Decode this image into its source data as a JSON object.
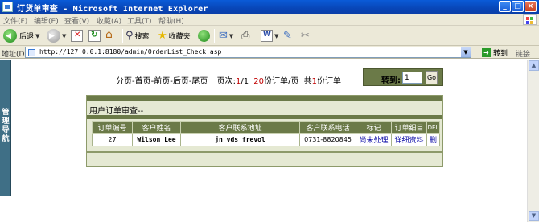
{
  "window": {
    "title": "订货单审查 - Microsoft Internet Explorer",
    "buttons": {
      "minimize": "_",
      "maximize": "□",
      "close": "×"
    }
  },
  "menu": [
    "文件(F)",
    "编辑(E)",
    "查看(V)",
    "收藏(A)",
    "工具(T)",
    "帮助(H)"
  ],
  "toolbar": {
    "back_label": "后退",
    "search_label": "搜索",
    "favorites_label": "收藏夹"
  },
  "address": {
    "label": "地址(D)",
    "url": "http://127.0.0.1:8180/admin/OrderList_Check.asp",
    "go_label": "转到",
    "links_label": "链接"
  },
  "sidebar": {
    "label": "管理导航"
  },
  "pager": {
    "first_parts": "分页-首页-前页-后页-尾页",
    "page_label": "页次:",
    "current_page": "1",
    "total_pages": "/1",
    "per_page": "20",
    "per_page_label": "份订单/页",
    "total_prefix": "共",
    "total_count": "1",
    "total_suffix": "份订单"
  },
  "jump": {
    "label": "转到:",
    "value": "1",
    "button": "Go"
  },
  "panel": {
    "title": "用户订单审查--",
    "columns": [
      "订单编号",
      "客户姓名",
      "客户联系地址",
      "客户联系电话",
      "标记",
      "订单细目",
      "DEL"
    ],
    "rows": [
      {
        "id": "27",
        "name": "Wilson Lee",
        "address": "jn vds frevol",
        "phone": "0731-8820845",
        "mark": "尚未处理",
        "detail": "详细资料",
        "del": "删"
      }
    ]
  }
}
